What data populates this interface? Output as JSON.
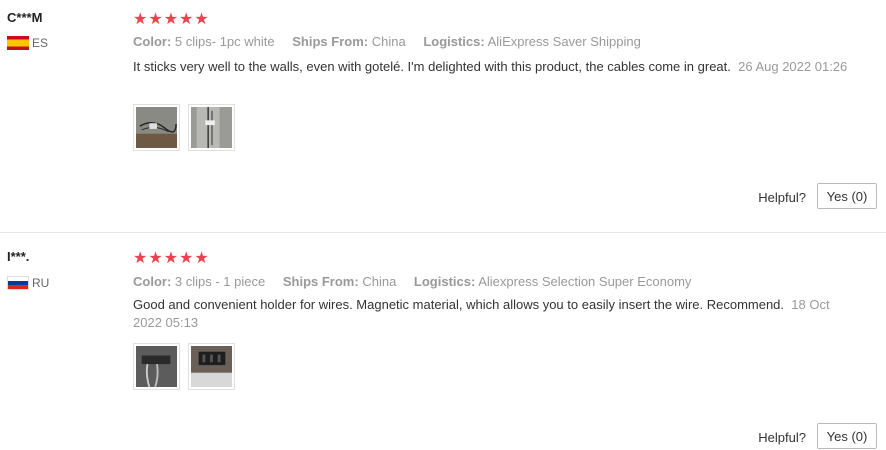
{
  "reviews": [
    {
      "user": "C***M",
      "country": "ES",
      "stars": "★★★★★",
      "rating": 5,
      "color_label": "Color:",
      "color_value": "5 clips- 1pc white",
      "ships_label": "Ships From:",
      "ships_value": "China",
      "logistics_label": "Logistics:",
      "logistics_value": "AliExpress Saver Shipping",
      "text": "It sticks very well to the walls, even with gotelé. I'm delighted with this product, the cables come in great.",
      "date": "26 Aug 2022 01:26",
      "photos": [
        "review-photo",
        "review-photo"
      ],
      "helpful_label": "Helpful?",
      "yes_label": "Yes (0)"
    },
    {
      "user": "I***.",
      "country": "RU",
      "stars": "★★★★★",
      "rating": 5,
      "color_label": "Color:",
      "color_value": "3 clips - 1 piece",
      "ships_label": "Ships From:",
      "ships_value": "China",
      "logistics_label": "Logistics:",
      "logistics_value": "Aliexpress Selection Super Economy",
      "text": "Good and convenient holder for wires. Magnetic material, which allows you to easily insert the wire. Recommend.",
      "date": "18 Oct 2022 05:13",
      "photos": [
        "review-photo",
        "review-photo"
      ],
      "helpful_label": "Helpful?",
      "yes_label": "Yes (0)"
    }
  ],
  "colors": {
    "star": "#e8434e",
    "muted": "#999999",
    "text": "#333333"
  }
}
